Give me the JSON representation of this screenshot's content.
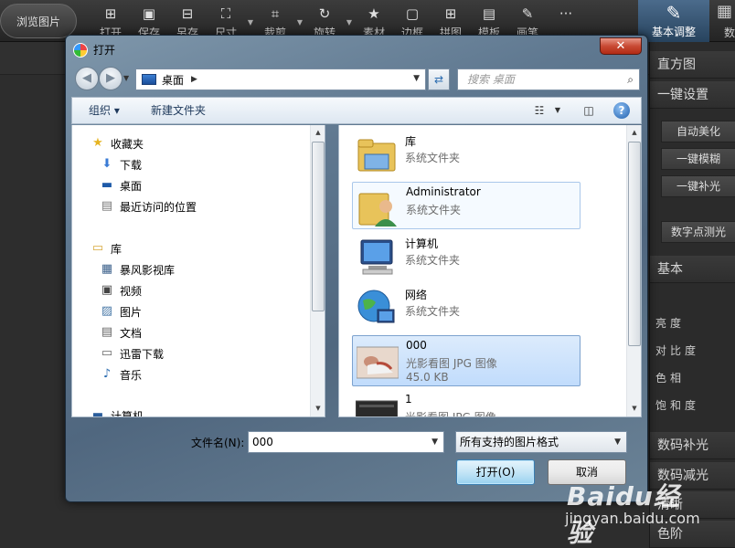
{
  "app": {
    "browse_label": "浏览图片",
    "tools": [
      {
        "label": "打开",
        "icon": "open-icon"
      },
      {
        "label": "保存",
        "icon": "save-icon"
      },
      {
        "label": "另存",
        "icon": "save-as-icon"
      },
      {
        "label": "尺寸",
        "icon": "resize-icon"
      },
      {
        "label": "裁剪",
        "icon": "crop-icon"
      },
      {
        "label": "旋转",
        "icon": "rotate-icon"
      },
      {
        "label": "素材",
        "icon": "star-icon"
      },
      {
        "label": "边框",
        "icon": "frame-icon"
      },
      {
        "label": "拼图",
        "icon": "grid-icon"
      },
      {
        "label": "模板",
        "icon": "template-icon"
      },
      {
        "label": "画笔",
        "icon": "brush-icon"
      },
      {
        "label": "···",
        "icon": "more-icon"
      }
    ],
    "tab_basic": "基本调整",
    "tab_next": "数"
  },
  "right_panel": {
    "histogram": "直方图",
    "one_click": "一键设置",
    "auto_beautify": "自动美化",
    "one_click_blur": "一键模糊",
    "one_click_fill": "一键补光",
    "spot_metering": "数字点测光",
    "basic": "基本",
    "brightness": "亮度",
    "contrast": "对比度",
    "hue": "色相",
    "saturation": "饱和度",
    "digital_fill": "数码补光",
    "digital_reduce": "数码减光",
    "sharpen": "清晰",
    "levels": "色阶"
  },
  "dialog": {
    "title": "打开",
    "close": "✕",
    "address": "桌面",
    "search_placeholder": "搜索 桌面",
    "organize": "组织 ▾",
    "new_folder": "新建文件夹",
    "favorites": "收藏夹",
    "downloads": "下载",
    "desktop": "桌面",
    "recent": "最近访问的位置",
    "libraries": "库",
    "storm_video": "暴风影视库",
    "videos": "视频",
    "pictures": "图片",
    "documents": "文档",
    "thunder_download": "迅雷下载",
    "music": "音乐",
    "computer": "计算机",
    "files": [
      {
        "name": "库",
        "type": "系统文件夹",
        "size": ""
      },
      {
        "name": "Administrator",
        "type": "系统文件夹",
        "size": ""
      },
      {
        "name": "计算机",
        "type": "系统文件夹",
        "size": ""
      },
      {
        "name": "网络",
        "type": "系统文件夹",
        "size": ""
      },
      {
        "name": "000",
        "type": "光影看图 JPG 图像",
        "size": "45.0 KB"
      },
      {
        "name": "1",
        "type": "光影看图 JPG 图像",
        "size": ""
      }
    ],
    "filename_label": "文件名(N):",
    "filename_value": "000",
    "filetype_value": "所有支持的图片格式",
    "open_button": "打开(O)",
    "cancel_button": "取消"
  },
  "watermark": {
    "logo": "Baidu经验",
    "url": "jingyan.baidu.com"
  }
}
